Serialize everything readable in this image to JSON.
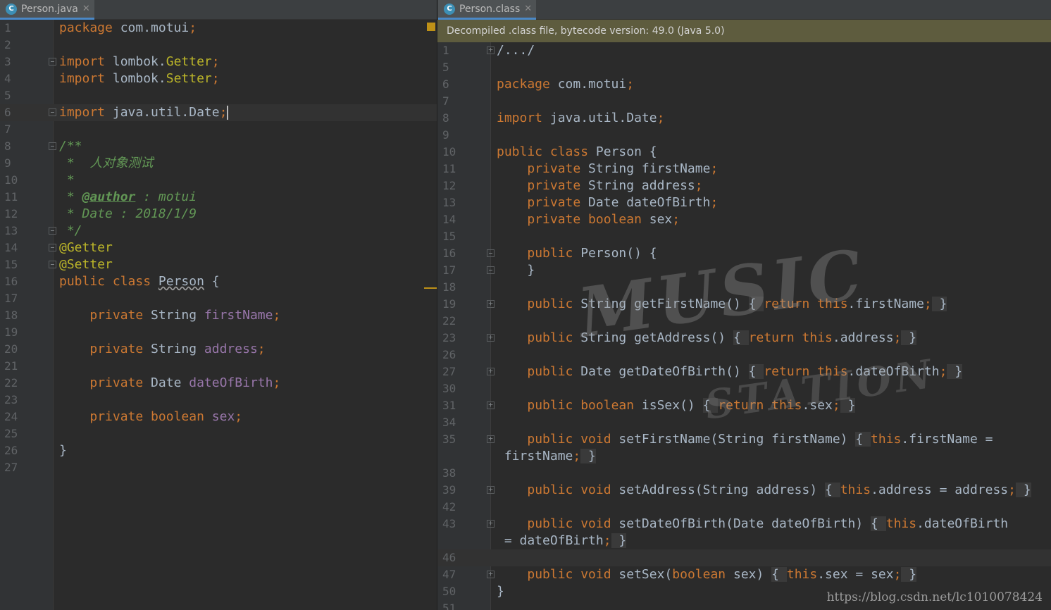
{
  "left": {
    "tab": {
      "icon": "C",
      "label": "Person.java"
    },
    "lines": [
      {
        "n": "1",
        "html": "<span class=\"kw\">package</span> com.motui<span class=\"kw\">;</span>"
      },
      {
        "n": "2",
        "html": ""
      },
      {
        "n": "3",
        "html": "<span class=\"kw\">import</span> lombok.<span class=\"ann\">Getter</span><span class=\"kw\">;</span>",
        "fold": "open"
      },
      {
        "n": "4",
        "html": "<span class=\"kw\">import</span> lombok.<span class=\"ann\">Setter</span><span class=\"kw\">;</span>"
      },
      {
        "n": "5",
        "html": ""
      },
      {
        "n": "6",
        "html": "<span class=\"kw\">import</span> java.util.Date<span class=\"kw\">;</span><span class=\"caret\"></span>",
        "fold": "open",
        "current": true
      },
      {
        "n": "7",
        "html": ""
      },
      {
        "n": "8",
        "html": "<span class=\"cmt\">/**</span>",
        "fold": "open"
      },
      {
        "n": "9",
        "html": "<span class=\"cmt\"> *  人对象测试</span>"
      },
      {
        "n": "10",
        "html": "<span class=\"cmt\"> *</span>"
      },
      {
        "n": "11",
        "html": "<span class=\"cmt\"> * </span><span class=\"tag\">@author</span><span class=\"cmt\"> : motui</span>"
      },
      {
        "n": "12",
        "html": "<span class=\"cmt\"> * Date : 2018/1/9</span>"
      },
      {
        "n": "13",
        "html": "<span class=\"cmt\"> */</span>",
        "fold": "open"
      },
      {
        "n": "14",
        "html": "<span class=\"ann\">@Getter</span>",
        "fold": "open"
      },
      {
        "n": "15",
        "html": "<span class=\"ann\">@Setter</span>",
        "fold": "open"
      },
      {
        "n": "16",
        "html": "<span class=\"kw\">public class</span> <span class=\"und\">Person</span> {"
      },
      {
        "n": "17",
        "html": ""
      },
      {
        "n": "18",
        "html": "    <span class=\"kw\">private</span> String <span class=\"fld\">firstName</span><span class=\"kw\">;</span>"
      },
      {
        "n": "19",
        "html": ""
      },
      {
        "n": "20",
        "html": "    <span class=\"kw\">private</span> String <span class=\"fld\">address</span><span class=\"kw\">;</span>"
      },
      {
        "n": "21",
        "html": ""
      },
      {
        "n": "22",
        "html": "    <span class=\"kw\">private</span> Date <span class=\"fld\">dateOfBirth</span><span class=\"kw\">;</span>"
      },
      {
        "n": "23",
        "html": ""
      },
      {
        "n": "24",
        "html": "    <span class=\"kw\">private boolean</span> <span class=\"fld\">sex</span><span class=\"kw\">;</span>"
      },
      {
        "n": "25",
        "html": ""
      },
      {
        "n": "26",
        "html": "}"
      },
      {
        "n": "27",
        "html": ""
      }
    ]
  },
  "right": {
    "tab": {
      "icon": "C",
      "label": "Person.class"
    },
    "banner": "Decompiled .class file, bytecode version: 49.0 (Java 5.0)",
    "lines": [
      {
        "n": "1",
        "html": "/.../",
        "fold": "plus"
      },
      {
        "n": "5",
        "html": ""
      },
      {
        "n": "6",
        "html": "<span class=\"kw\">package</span> com.motui<span class=\"kw\">;</span>"
      },
      {
        "n": "7",
        "html": ""
      },
      {
        "n": "8",
        "html": "<span class=\"kw\">import</span> java.util.Date<span class=\"kw\">;</span>"
      },
      {
        "n": "9",
        "html": ""
      },
      {
        "n": "10",
        "html": "<span class=\"kw\">public class</span> Person {"
      },
      {
        "n": "11",
        "html": "    <span class=\"kw\">private</span> String firstName<span class=\"kw\">;</span>"
      },
      {
        "n": "12",
        "html": "    <span class=\"kw\">private</span> String address<span class=\"kw\">;</span>"
      },
      {
        "n": "13",
        "html": "    <span class=\"kw\">private</span> Date dateOfBirth<span class=\"kw\">;</span>"
      },
      {
        "n": "14",
        "html": "    <span class=\"kw\">private boolean</span> sex<span class=\"kw\">;</span>"
      },
      {
        "n": "15",
        "html": ""
      },
      {
        "n": "16",
        "html": "    <span class=\"kw\">public</span> Person() {",
        "fold": "open"
      },
      {
        "n": "17",
        "html": "    }",
        "fold": "open"
      },
      {
        "n": "18",
        "html": ""
      },
      {
        "n": "19",
        "html": "    <span class=\"kw\">public</span> String getFirstName() <span class=\"fold-bg\">{ </span><span class=\"kw\">return this</span>.firstName<span class=\"kw\">;</span><span class=\"fold-bg\"> }</span>",
        "fold": "plus"
      },
      {
        "n": "22",
        "html": ""
      },
      {
        "n": "23",
        "html": "    <span class=\"kw\">public</span> String getAddress() <span class=\"fold-bg\">{ </span><span class=\"kw\">return this</span>.address<span class=\"kw\">;</span><span class=\"fold-bg\"> }</span>",
        "fold": "plus"
      },
      {
        "n": "26",
        "html": ""
      },
      {
        "n": "27",
        "html": "    <span class=\"kw\">public</span> Date getDateOfBirth() <span class=\"fold-bg\">{ </span><span class=\"kw\">return this</span>.dateOfBirth<span class=\"kw\">;</span><span class=\"fold-bg\"> }</span>",
        "fold": "plus"
      },
      {
        "n": "30",
        "html": ""
      },
      {
        "n": "31",
        "html": "    <span class=\"kw\">public boolean</span> isSex() <span class=\"fold-bg\">{ </span><span class=\"kw\">return this</span>.sex<span class=\"kw\">;</span><span class=\"fold-bg\"> }</span>",
        "fold": "plus"
      },
      {
        "n": "34",
        "html": ""
      },
      {
        "n": "35",
        "html": "    <span class=\"kw\">public void</span> setFirstName(String firstName) <span class=\"fold-bg\">{ </span><span class=\"kw\">this</span>.firstName =",
        "fold": "plus"
      },
      {
        "n": "",
        "html": " firstName<span class=\"kw\">;</span><span class=\"fold-bg\"> }</span>"
      },
      {
        "n": "38",
        "html": ""
      },
      {
        "n": "39",
        "html": "    <span class=\"kw\">public void</span> setAddress(String address) <span class=\"fold-bg\">{ </span><span class=\"kw\">this</span>.address = address<span class=\"kw\">;</span><span class=\"fold-bg\"> }</span>",
        "fold": "plus"
      },
      {
        "n": "42",
        "html": ""
      },
      {
        "n": "43",
        "html": "    <span class=\"kw\">public void</span> setDateOfBirth(Date dateOfBirth) <span class=\"fold-bg\">{ </span><span class=\"kw\">this</span>.dateOfBirth",
        "fold": "plus"
      },
      {
        "n": "",
        "html": " = dateOfBirth<span class=\"kw\">;</span><span class=\"fold-bg\"> }</span>"
      },
      {
        "n": "46",
        "html": "",
        "current": true
      },
      {
        "n": "47",
        "html": "    <span class=\"kw\">public void</span> setSex(<span class=\"kw\">boolean</span> sex) <span class=\"fold-bg\">{ </span><span class=\"kw\">this</span>.sex = sex<span class=\"kw\">;</span><span class=\"fold-bg\"> }</span>",
        "fold": "plus"
      },
      {
        "n": "50",
        "html": "}"
      },
      {
        "n": "51",
        "html": ""
      }
    ]
  },
  "watermark": {
    "line1": "MUSIC",
    "line2": "STATION"
  },
  "source_url": "https://blog.csdn.net/lc1010078424"
}
